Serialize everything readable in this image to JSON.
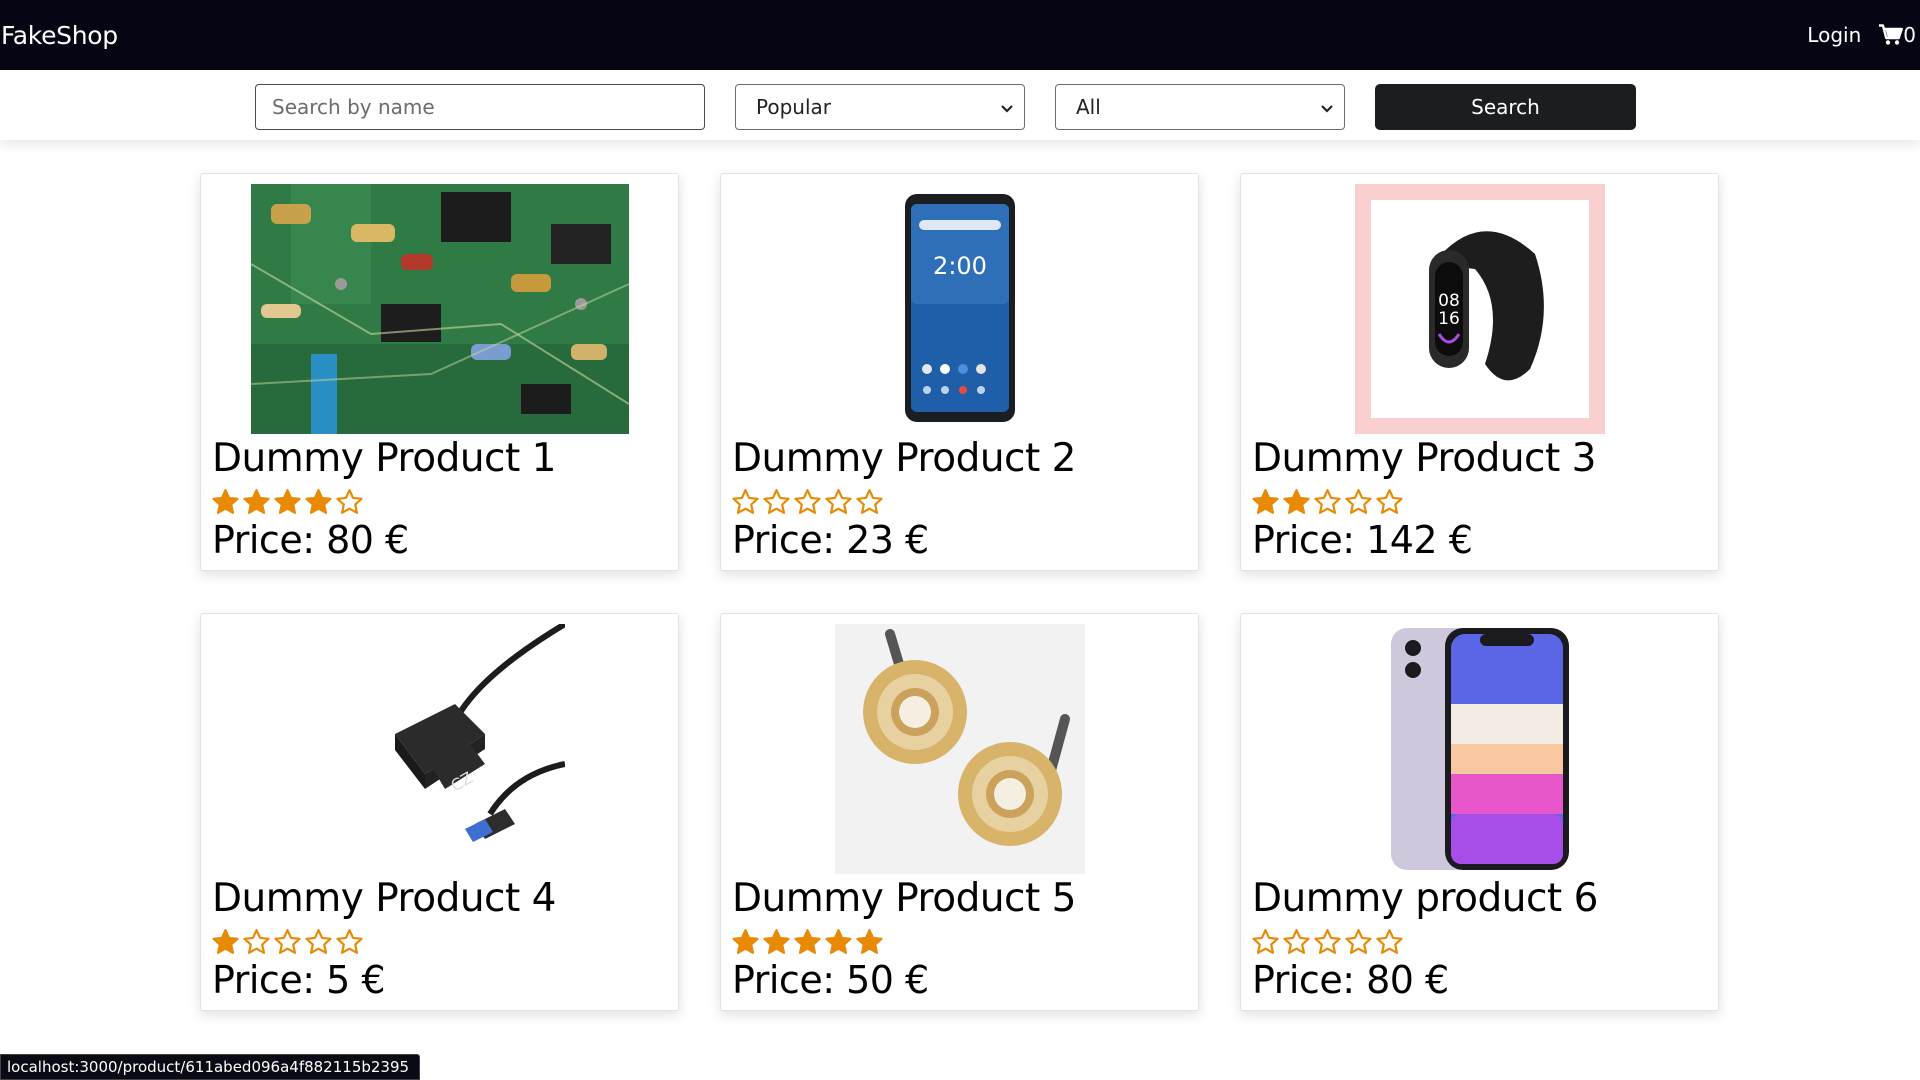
{
  "navbar": {
    "brand": "FakeShop",
    "login_label": "Login",
    "cart_count": "0"
  },
  "filters": {
    "search_placeholder": "Search by name",
    "sort_selected": "Popular",
    "category_selected": "All",
    "search_button_label": "Search"
  },
  "products": [
    {
      "name": "Dummy Product 1",
      "rating": 4,
      "price_label": "Price: 80 €",
      "image": "circuit-board"
    },
    {
      "name": "Dummy Product 2",
      "rating": 0,
      "price_label": "Price: 23 €",
      "image": "smartphone"
    },
    {
      "name": "Dummy Product 3",
      "rating": 2,
      "price_label": "Price: 142 €",
      "image": "fitness-band"
    },
    {
      "name": "Dummy Product 4",
      "rating": 1,
      "price_label": "Price: 5 €",
      "image": "sata-usb-adapter"
    },
    {
      "name": "Dummy Product 5",
      "rating": 5,
      "price_label": "Price: 50 €",
      "image": "hair-clips"
    },
    {
      "name": "Dummy product 6",
      "rating": 0,
      "price_label": "Price: 80 €",
      "image": "iphone"
    }
  ],
  "rating_max": 5,
  "colors": {
    "navbar_bg": "#050513",
    "star": "#e88a06",
    "button_bg": "#1b1e21"
  },
  "statusbar": {
    "url": "localhost:3000/product/611abed096a4f882115b2395"
  }
}
